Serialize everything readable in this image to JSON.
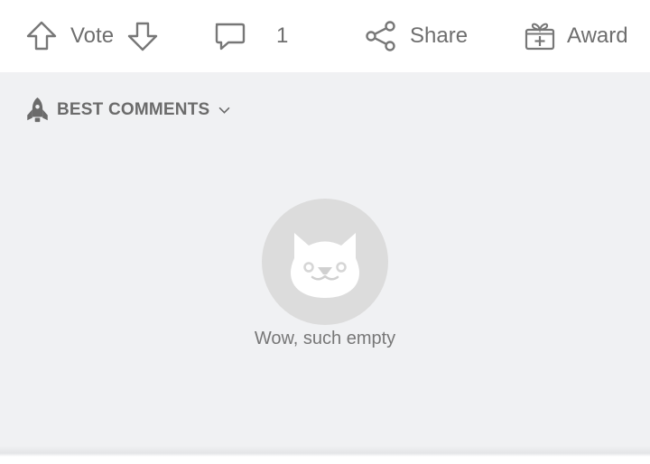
{
  "actions": {
    "vote_label": "Vote",
    "comment_count": "1",
    "share_label": "Share",
    "award_label": "Award"
  },
  "sort": {
    "label": "BEST COMMENTS"
  },
  "empty_state": {
    "message": "Wow, such empty"
  },
  "icons": {
    "upvote": "arrow-up-outline",
    "downvote": "arrow-down-outline",
    "comment": "speech-bubble",
    "share": "share-nodes",
    "award": "gift-box",
    "sort": "rocket",
    "dropdown": "chevron-down",
    "empty": "cat-face"
  },
  "colors": {
    "background": "#f0f1f3",
    "bar": "#ffffff",
    "icon": "#7a7a7a",
    "avatar": "#dcdcdc"
  }
}
